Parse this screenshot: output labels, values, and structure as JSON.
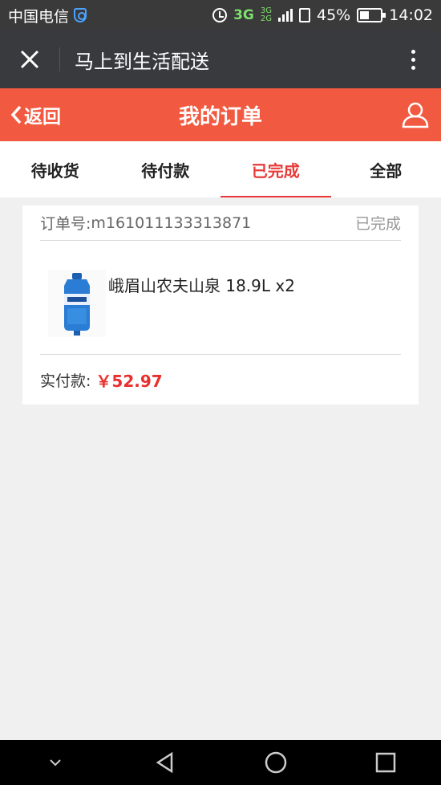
{
  "status_bar": {
    "carrier": "中国电信",
    "network": "3G",
    "network_small_top": "3G",
    "network_small_bottom": "2G",
    "battery": "45%",
    "battery_level": 0.45,
    "time": "14:02"
  },
  "app_bar": {
    "title": "马上到生活配送"
  },
  "header": {
    "back_label": "返回",
    "title": "我的订单"
  },
  "tabs": [
    {
      "label": "待收货",
      "active": false
    },
    {
      "label": "待付款",
      "active": false
    },
    {
      "label": "已完成",
      "active": true
    },
    {
      "label": "全部",
      "active": false
    }
  ],
  "order": {
    "number_label": "订单号:",
    "number": "m161011133313871",
    "status": "已完成",
    "product_name": "峨眉山农夫山泉 18.9L x2",
    "paid_label": "实付款:",
    "paid_amount": "￥52.97"
  },
  "colors": {
    "accent": "#f15a40",
    "active_tab": "#e83a3a",
    "price": "#e8302f",
    "title_bar": "#393a3e"
  }
}
